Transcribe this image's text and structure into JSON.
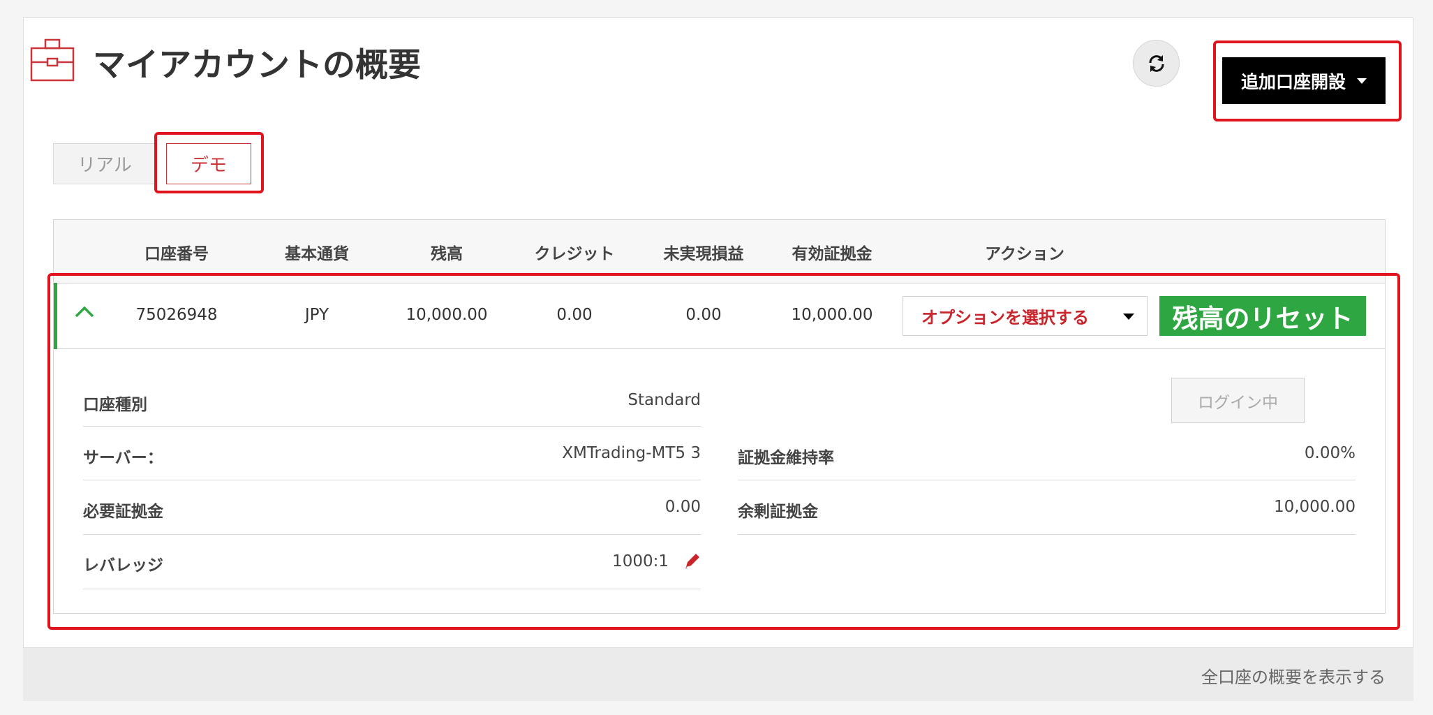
{
  "header": {
    "title": "マイアカウントの概要",
    "add_account_label": "追加口座開設",
    "icons": {
      "title_icon": "briefcase-icon",
      "refresh": "refresh-icon"
    }
  },
  "tabs": [
    {
      "label": "リアル",
      "active": false
    },
    {
      "label": "デモ",
      "active": true
    }
  ],
  "table": {
    "columns": [
      "口座番号",
      "基本通貨",
      "残高",
      "クレジット",
      "未実現損益",
      "有効証拠金",
      "アクション"
    ],
    "row": {
      "account_number": "75026948",
      "currency": "JPY",
      "balance": "10,000.00",
      "credit": "0.00",
      "unrealized_pl": "0.00",
      "equity": "10,000.00",
      "option_select_label": "オプションを選択する",
      "reset_balance_label": "残高のリセット"
    }
  },
  "details": {
    "left": [
      {
        "label": "口座種別",
        "value": "Standard"
      },
      {
        "label": "サーバー：",
        "value": "XMTrading-MT5 3"
      },
      {
        "label": "必要証拠金",
        "value": "0.00"
      },
      {
        "label": "レバレッジ",
        "value": "1000:1"
      }
    ],
    "right": [
      {
        "label": "証拠金維持率",
        "value": "0.00%"
      },
      {
        "label": "余剰証拠金",
        "value": "10,000.00"
      }
    ],
    "login_label": "ログイン中"
  },
  "footer": {
    "link_label": "全口座の概要を表示する"
  },
  "colors": {
    "accent_red": "#c9353b",
    "highlight_red": "#e1131c",
    "green": "#2ea641"
  }
}
